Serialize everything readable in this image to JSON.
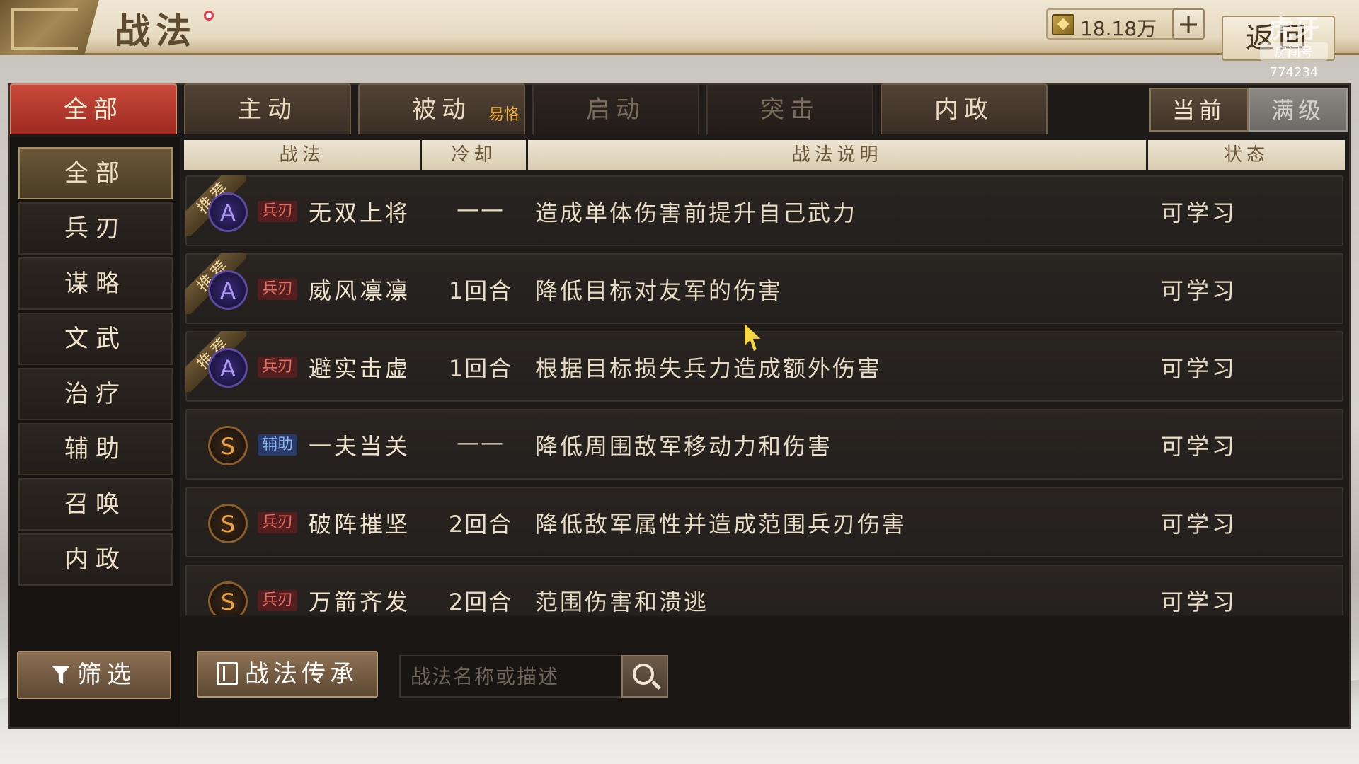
{
  "header": {
    "title": "战法",
    "currency_value": "18.18万",
    "add_label": "+",
    "back_label": "返回"
  },
  "room_badge": {
    "logo": "虎牙",
    "label": "房间号",
    "number": "774234"
  },
  "tabs": [
    {
      "label": "全部",
      "active": true
    },
    {
      "label": "主动"
    },
    {
      "label": "被动",
      "badge": "易恪"
    },
    {
      "label": "启动",
      "dim": true
    },
    {
      "label": "突击",
      "dim": true
    },
    {
      "label": "内政"
    }
  ],
  "level_toggle": {
    "current": "当前",
    "max": "满级"
  },
  "sidebar": {
    "items": [
      "全部",
      "兵刃",
      "谋略",
      "文武",
      "治疗",
      "辅助",
      "召唤",
      "内政"
    ],
    "filter_label": "筛选"
  },
  "table": {
    "headers": {
      "skill": "战法",
      "cooldown": "冷却",
      "desc": "战法说明",
      "status": "状态"
    },
    "rec_label": "推荐",
    "rows": [
      {
        "recommended": true,
        "grade": "A",
        "type": "兵刃",
        "name": "无双上将",
        "cooldown": "——",
        "desc": "造成单体伤害前提升自己武力",
        "status": "可学习"
      },
      {
        "recommended": true,
        "grade": "A",
        "type": "兵刃",
        "name": "威风凛凛",
        "cooldown": "1回合",
        "desc": "降低目标对友军的伤害",
        "status": "可学习"
      },
      {
        "recommended": true,
        "grade": "A",
        "type": "兵刃",
        "name": "避实击虚",
        "cooldown": "1回合",
        "desc": "根据目标损失兵力造成额外伤害",
        "status": "可学习"
      },
      {
        "recommended": false,
        "grade": "S",
        "type": "辅助",
        "name": "一夫当关",
        "cooldown": "——",
        "desc": "降低周围敌军移动力和伤害",
        "status": "可学习"
      },
      {
        "recommended": false,
        "grade": "S",
        "type": "兵刃",
        "name": "破阵摧坚",
        "cooldown": "2回合",
        "desc": "降低敌军属性并造成范围兵刃伤害",
        "status": "可学习"
      },
      {
        "recommended": false,
        "grade": "S",
        "type": "兵刃",
        "name": "万箭齐发",
        "cooldown": "2回合",
        "desc": "范围伤害和溃逃",
        "status": "可学习"
      }
    ]
  },
  "bottom": {
    "inherit_label": "战法传承",
    "search_placeholder": "战法名称或描述"
  }
}
